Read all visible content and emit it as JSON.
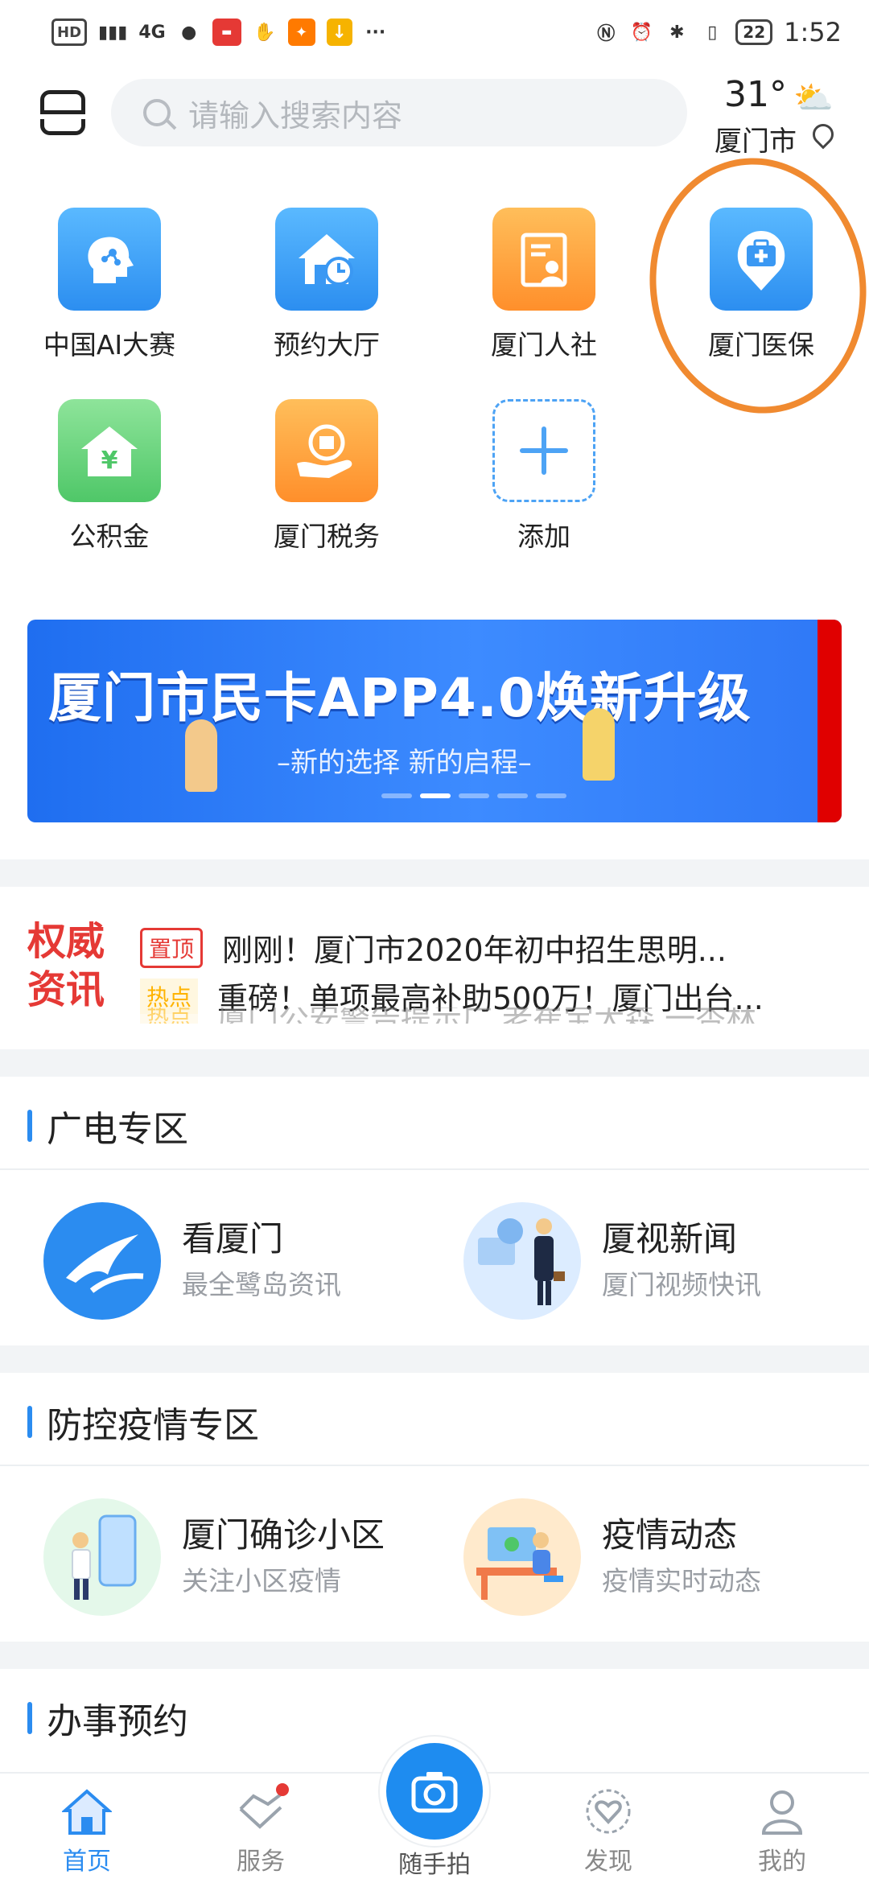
{
  "status_bar": {
    "hd": "HD",
    "network": "4G",
    "battery": "22",
    "time": "1:52"
  },
  "header": {
    "search_placeholder": "请输入搜索内容",
    "temperature": "31°",
    "city": "厦门市"
  },
  "apps": [
    {
      "label": "中国AI大赛",
      "icon": "ai-brain-icon"
    },
    {
      "label": "预约大厅",
      "icon": "house-clock-icon"
    },
    {
      "label": "厦门人社",
      "icon": "id-card-icon"
    },
    {
      "label": "厦门医保",
      "icon": "medical-kit-icon"
    },
    {
      "label": "公积金",
      "icon": "house-yuan-icon"
    },
    {
      "label": "厦门税务",
      "icon": "tax-hand-icon"
    },
    {
      "label": "添加",
      "icon": "plus-icon"
    }
  ],
  "banner": {
    "title": "厦门市民卡APP4.0焕新升级",
    "subtitle": "–新的选择 新的启程–"
  },
  "news": {
    "label_line1": "权威",
    "label_line2": "资讯",
    "items": [
      {
        "badge": "置顶",
        "text": "刚刚！厦门市2020年初中招生思明..."
      },
      {
        "badge": "热点",
        "text": "重磅！单项最高补助500万！厦门出台..."
      },
      {
        "badge": "热点",
        "text": "厦门公安警告提示广 老崔宝大森 一杏林"
      }
    ]
  },
  "sections": {
    "broadcast": {
      "title": "广电专区",
      "cards": [
        {
          "title": "看厦门",
          "subtitle": "最全鹭岛资讯"
        },
        {
          "title": "厦视新闻",
          "subtitle": "厦门视频快讯"
        }
      ]
    },
    "epidemic": {
      "title": "防控疫情专区",
      "cards": [
        {
          "title": "厦门确诊小区",
          "subtitle": "关注小区疫情"
        },
        {
          "title": "疫情动态",
          "subtitle": "疫情实时动态"
        }
      ]
    },
    "appointment": {
      "title": "办事预约"
    }
  },
  "bottom_nav": {
    "home": "首页",
    "service": "服务",
    "camera": "随手拍",
    "discover": "发现",
    "mine": "我的"
  },
  "colors": {
    "accent": "#2b8cf0",
    "news_red": "#e53935",
    "annotation_orange": "#f08a30"
  }
}
